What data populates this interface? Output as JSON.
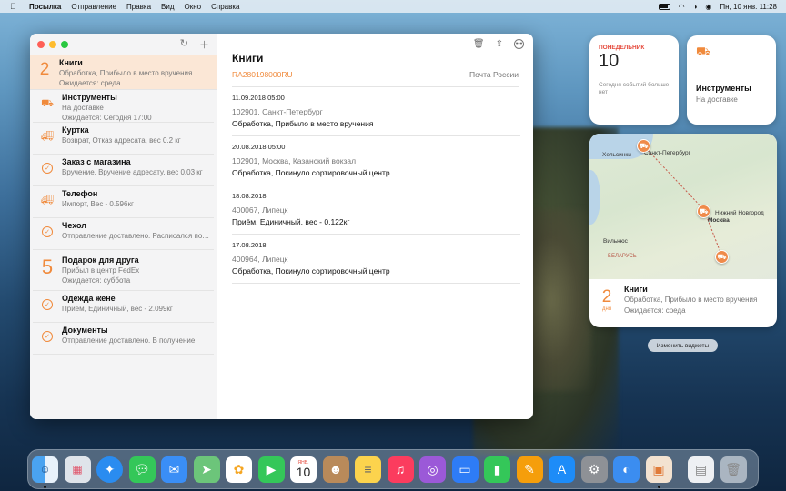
{
  "menubar": {
    "app_name": "Посылка",
    "menus": [
      "Отправление",
      "Правка",
      "Вид",
      "Окно",
      "Справка"
    ],
    "clock": "Пн, 10 янв.  11:28"
  },
  "sidebar": {
    "items": [
      {
        "icon": "number",
        "number": "2",
        "title": "Книги",
        "line1": "Обработка, Прибыло в место вручения",
        "line2": "Ожидается: среда",
        "selected": true
      },
      {
        "icon": "dolly-icon",
        "title": "Инструменты",
        "line1": "На доставке",
        "line2": "Ожидается: Сегодня 17:00"
      },
      {
        "icon": "truck-icon",
        "title": "Куртка",
        "line1": "Возврат, Отказ адресата, вес 0.2 кг"
      },
      {
        "icon": "check-icon",
        "title": "Заказ с магазина",
        "line1": "Вручение, Вручение адресату, вес 0.03 кг"
      },
      {
        "icon": "truck-icon",
        "title": "Телефон",
        "line1": "Импорт, Вес - 0.596кг"
      },
      {
        "icon": "check-icon",
        "title": "Чехол",
        "line1": "Отправление доставлено. Расписался получатель"
      },
      {
        "icon": "number",
        "number": "5",
        "title": "Подарок для друга",
        "line1": "Прибыл в центр FedEx",
        "line2": "Ожидается: суббота"
      },
      {
        "icon": "check-icon",
        "title": "Одежда жене",
        "line1": "Приём, Единичный, вес - 2.099кг"
      },
      {
        "icon": "check-icon",
        "title": "Документы",
        "line1": "Отправление доставлено. В получение"
      }
    ]
  },
  "detail": {
    "title": "Книги",
    "tracking": "RA280198000RU",
    "carrier": "Почта России",
    "events": [
      {
        "date": "11.09.2018 05:00",
        "location": "102901, Санкт-Петербург",
        "status": "Обработка, Прибыло в место вручения"
      },
      {
        "date": "20.08.2018 05:00",
        "location": "102901, Москва, Казанский вокзал",
        "status": "Обработка, Покинуло сортировочный центр"
      },
      {
        "date": "18.08.2018",
        "location": "400067, Липецк",
        "status": "Приём, Единичный, вес - 0.122кг"
      },
      {
        "date": "17.08.2018",
        "location": "400964, Липецк",
        "status": "Обработка, Покинуло сортировочный центр"
      }
    ]
  },
  "widgets": {
    "calendar": {
      "weekday": "ПОНЕДЕЛЬНИК",
      "day": "10",
      "note": "Сегодня событий больше нет"
    },
    "package_small": {
      "title": "Инструменты",
      "status": "На доставке"
    },
    "package_large": {
      "map_labels": {
        "helsinki": "Хельсинки",
        "spb": "Санкт-Петербург",
        "nnov": "Нижний Новгород",
        "moscow": "Москва",
        "vilnius": "Вильнюс",
        "belarus": "БЕЛАРУСЬ"
      },
      "number": "2",
      "number_unit": "дня",
      "title": "Книги",
      "line1": "Обработка, Прибыло в место вручения",
      "line2": "Ожидается: среда"
    },
    "edit_label": "Изменить виджеты"
  },
  "dock": {
    "calendar_month": "ЯНВ.",
    "calendar_day": "10",
    "apps": [
      "finder-icon",
      "launchpad-icon",
      "safari-icon",
      "messages-icon",
      "mail-icon",
      "maps-icon",
      "photos-icon",
      "facetime-icon",
      "calendar-icon",
      "contacts-icon",
      "notes-icon",
      "music-icon",
      "podcasts-icon",
      "keynote-icon",
      "numbers-icon",
      "pages-icon",
      "app-store-icon",
      "system-preferences-icon",
      "translate-icon",
      "parcel-icon",
      "document-icon",
      "trash-icon"
    ]
  },
  "colors": {
    "accent": "#f08a3c",
    "selected_row": "#fbe7d6"
  }
}
